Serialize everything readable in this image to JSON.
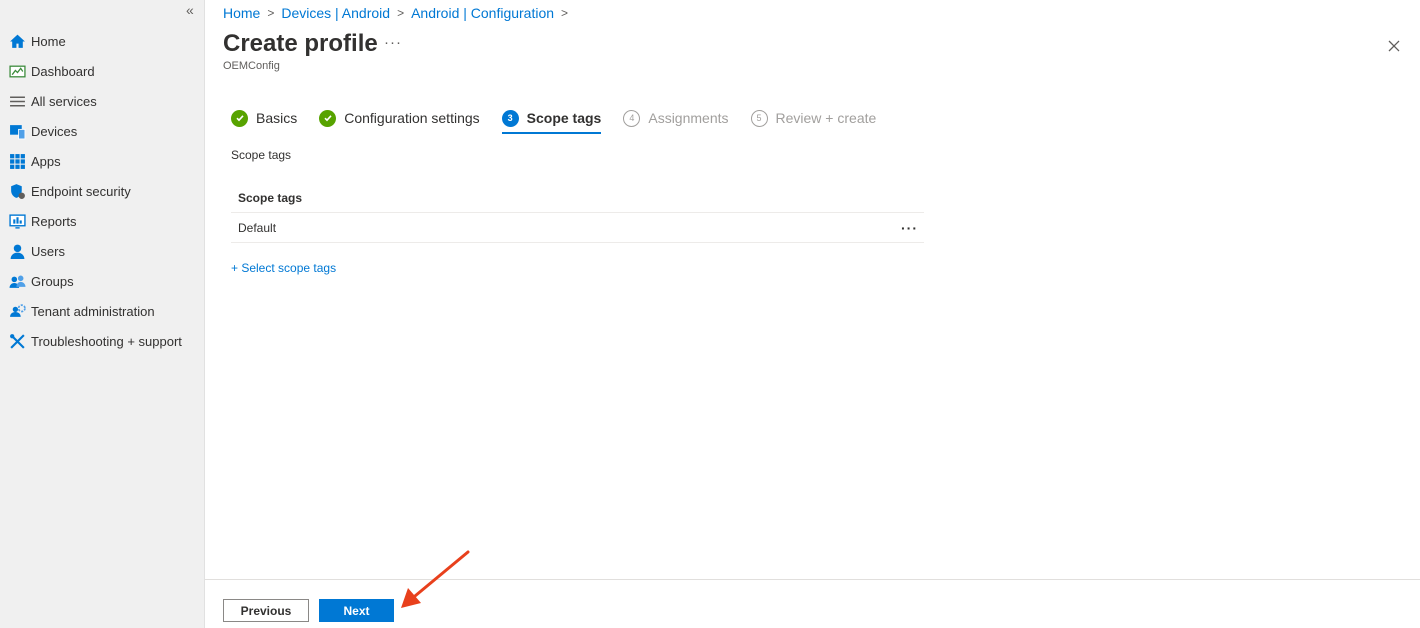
{
  "sidebar": {
    "collapse_glyph": "«",
    "items": [
      {
        "label": "Home",
        "icon": "home-icon"
      },
      {
        "label": "Dashboard",
        "icon": "dashboard-icon"
      },
      {
        "label": "All services",
        "icon": "list-icon"
      },
      {
        "label": "Devices",
        "icon": "devices-icon"
      },
      {
        "label": "Apps",
        "icon": "apps-icon"
      },
      {
        "label": "Endpoint security",
        "icon": "shield-icon"
      },
      {
        "label": "Reports",
        "icon": "reports-icon"
      },
      {
        "label": "Users",
        "icon": "user-icon"
      },
      {
        "label": "Groups",
        "icon": "groups-icon"
      },
      {
        "label": "Tenant administration",
        "icon": "tenant-admin-icon"
      },
      {
        "label": "Troubleshooting + support",
        "icon": "tools-icon"
      }
    ]
  },
  "breadcrumb": [
    "Home",
    "Devices | Android",
    "Android | Configuration"
  ],
  "header": {
    "title": "Create profile",
    "more": "···",
    "subtitle": "OEMConfig"
  },
  "wizard": {
    "steps": [
      {
        "label": "Basics",
        "state": "done",
        "marker": ""
      },
      {
        "label": "Configuration settings",
        "state": "done",
        "marker": ""
      },
      {
        "label": "Scope tags",
        "state": "active",
        "marker": "3"
      },
      {
        "label": "Assignments",
        "state": "todo",
        "marker": "4"
      },
      {
        "label": "Review + create",
        "state": "todo",
        "marker": "5"
      }
    ]
  },
  "section_label": "Scope tags",
  "table": {
    "header": "Scope tags",
    "rows": [
      {
        "value": "Default",
        "more": "···"
      }
    ]
  },
  "select_link": "+ Select scope tags",
  "footer": {
    "previous_label": "Previous",
    "next_label": "Next"
  },
  "colors": {
    "accent": "#0078d4",
    "success": "#57a300",
    "annotation_arrow": "#e8401c"
  }
}
